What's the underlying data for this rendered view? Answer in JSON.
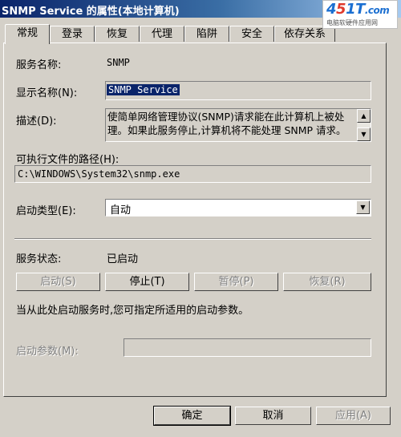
{
  "window": {
    "title": "SNMP Service 的属性(本地计算机)"
  },
  "watermark": {
    "logo_a": "4",
    "logo_b": "5",
    "logo_c": "1T",
    "logo_d": ".com",
    "subtitle": "电脑软硬件应用网"
  },
  "tabs": [
    {
      "label": "常规"
    },
    {
      "label": "登录"
    },
    {
      "label": "恢复"
    },
    {
      "label": "代理"
    },
    {
      "label": "陷阱"
    },
    {
      "label": "安全"
    },
    {
      "label": "依存关系"
    }
  ],
  "general": {
    "service_name_label": "服务名称:",
    "service_name_value": "SNMP",
    "display_name_label": "显示名称(N):",
    "display_name_value": "SNMP Service",
    "description_label": "描述(D):",
    "description_value": "使简单网络管理协议(SNMP)请求能在此计算机上被处理。如果此服务停止,计算机将不能处理 SNMP 请求。如果此服务被禁用,所有明确",
    "path_label": "可执行文件的路径(H):",
    "path_value": "C:\\WINDOWS\\System32\\snmp.exe",
    "startup_type_label": "启动类型(E):",
    "startup_type_value": "自动",
    "status_label": "服务状态:",
    "status_value": "已启动",
    "start_button": "启动(S)",
    "stop_button": "停止(T)",
    "pause_button": "暂停(P)",
    "resume_button": "恢复(R)",
    "hint_text": "当从此处启动服务时,您可指定所适用的启动参数。",
    "params_label": "启动参数(M):",
    "params_value": ""
  },
  "footer": {
    "ok_button": "确定",
    "cancel_button": "取消",
    "apply_button": "应用(A)"
  }
}
